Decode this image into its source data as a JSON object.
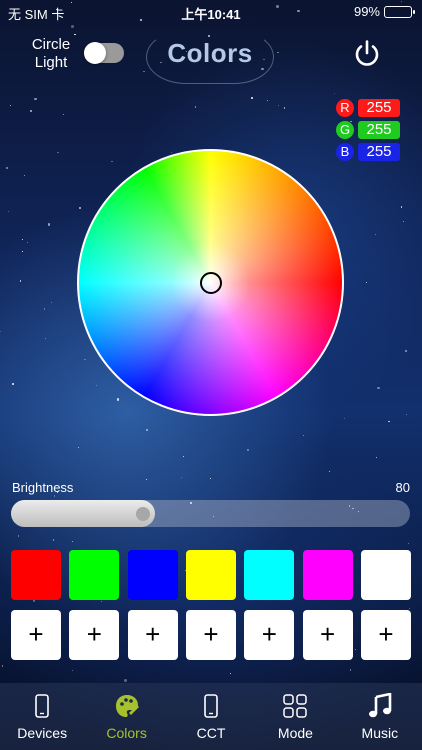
{
  "status_bar": {
    "carrier": "无 SIM 卡",
    "time": "上午10:41",
    "battery": "99%",
    "battery_level": 0.99
  },
  "header": {
    "circle_light_label": "Circle Light",
    "circle_light_on": false,
    "title": "Colors"
  },
  "rgb": [
    {
      "label": "R",
      "value": "255",
      "color": "#ff1a1a"
    },
    {
      "label": "G",
      "value": "255",
      "color": "#1ecb1e"
    },
    {
      "label": "B",
      "value": "255",
      "color": "#1a24e6"
    }
  ],
  "brightness": {
    "label": "Brightness",
    "value": "80",
    "level": 0.36
  },
  "swatches": [
    "#ff0000",
    "#00ff00",
    "#0000ff",
    "#ffff00",
    "#00ffff",
    "#ff00ff",
    "#ffffff"
  ],
  "add_buttons": [
    "+",
    "+",
    "+",
    "+",
    "+",
    "+",
    "+"
  ],
  "tabs": [
    {
      "label": "Devices",
      "icon": "phone-icon",
      "active": false
    },
    {
      "label": "Colors",
      "icon": "palette-icon",
      "active": true
    },
    {
      "label": "CCT",
      "icon": "phone-icon",
      "active": false
    },
    {
      "label": "Mode",
      "icon": "grid-icon",
      "active": false
    },
    {
      "label": "Music",
      "icon": "music-note-icon",
      "active": false
    }
  ],
  "colors": {
    "active_tab": "#a6c12d",
    "title": "#b5c8e6"
  }
}
